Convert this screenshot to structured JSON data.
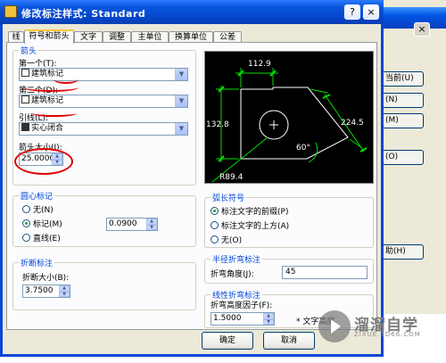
{
  "dialog": {
    "title": "修改标注样式: Standard",
    "help_button": "?",
    "close_button": "×"
  },
  "tabs": [
    {
      "label": "线"
    },
    {
      "label": "符号和箭头",
      "active": true
    },
    {
      "label": "文字"
    },
    {
      "label": "调整"
    },
    {
      "label": "主单位"
    },
    {
      "label": "换算单位"
    },
    {
      "label": "公差"
    }
  ],
  "arrowheads": {
    "group_label": "箭头",
    "first_label": "第一个(T):",
    "first_value": "建筑标记",
    "second_label": "第二个(D):",
    "second_value": "建筑标记",
    "leader_label": "引线(L):",
    "leader_value": "实心闭合",
    "size_label": "箭头大小(I):",
    "size_value": "25.0000"
  },
  "center_marks": {
    "group_label": "圆心标记",
    "options": [
      {
        "label": "无(N)",
        "selected": false
      },
      {
        "label": "标记(M)",
        "selected": true
      },
      {
        "label": "直线(E)",
        "selected": false
      }
    ],
    "size_value": "0.0900"
  },
  "dim_break": {
    "group_label": "折断标注",
    "size_label": "折断大小(B):",
    "size_value": "3.7500"
  },
  "arc_length": {
    "group_label": "弧长符号",
    "options": [
      {
        "label": "标注文字的前缀(P)",
        "selected": true
      },
      {
        "label": "标注文字的上方(A)",
        "selected": false
      },
      {
        "label": "无(O)",
        "selected": false
      }
    ]
  },
  "radius_jog": {
    "group_label": "半径折弯标注",
    "angle_label": "折弯角度(J):",
    "angle_value": "45"
  },
  "linear_jog": {
    "group_label": "线性折弯标注",
    "factor_label": "折弯高度因子(F):",
    "factor_value": "1.5000",
    "suffix": "* 文字高度"
  },
  "preview": {
    "dim_top": "112.9",
    "dim_left": "132.8",
    "dim_right": "224.5",
    "dim_angle": "60°",
    "dim_radius": "R89.4"
  },
  "buttons": {
    "ok": "确定",
    "cancel": "取消"
  },
  "background_window": {
    "buttons": [
      "当前(U)",
      "(N)",
      "(M)",
      "(O)",
      "助(H)"
    ]
  },
  "watermark": {
    "title": "溜溜自学",
    "subtitle": "ZIXUE.3D66.COM"
  },
  "colors": {
    "titlebar": "#0855dd",
    "group_label": "#0046d5",
    "annotation_red": "#e00000",
    "preview_dim_green": "#00e000"
  }
}
